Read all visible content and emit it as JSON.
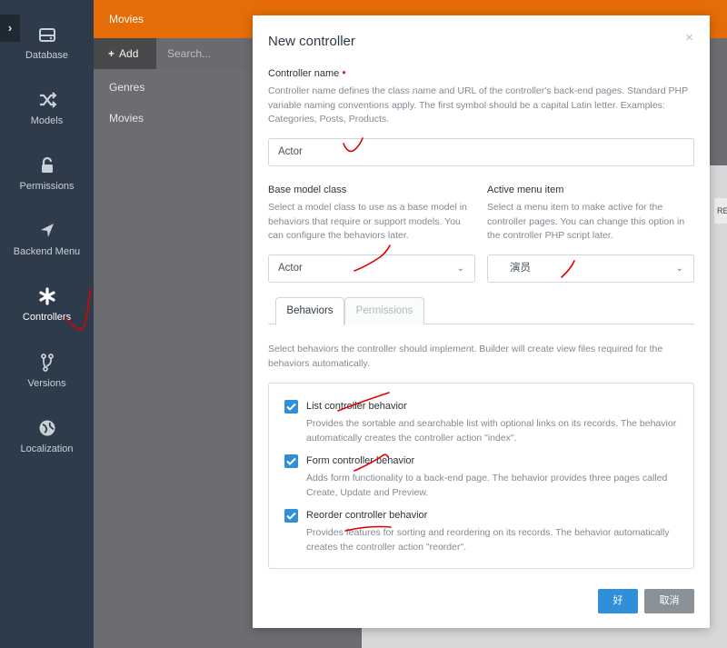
{
  "nav": {
    "items": [
      {
        "label": "Database",
        "icon": "database-icon"
      },
      {
        "label": "Models",
        "icon": "shuffle-icon"
      },
      {
        "label": "Permissions",
        "icon": "lock-icon"
      },
      {
        "label": "Backend Menu",
        "icon": "location-arrow-icon"
      },
      {
        "label": "Controllers",
        "icon": "asterisk-icon"
      },
      {
        "label": "Versions",
        "icon": "code-fork-icon"
      },
      {
        "label": "Localization",
        "icon": "globe-icon"
      }
    ],
    "active": "Controllers"
  },
  "background": {
    "plugin_title": "Movies",
    "add_label": "Add",
    "search_placeholder": "Search...",
    "list": [
      "Genres",
      "Movies"
    ],
    "column_hint": "RE"
  },
  "modal": {
    "title": "New controller",
    "close_symbol": "×",
    "controller_name": {
      "label": "Controller name",
      "required_mark": "•",
      "help": "Controller name defines the class name and URL of the controller's back-end pages. Standard PHP variable naming conventions apply. The first symbol should be a capital Latin letter. Examples: Categories, Posts, Products.",
      "value": "Actor"
    },
    "base_model": {
      "label": "Base model class",
      "help": "Select a model class to use as a base model in behaviors that require or support models. You can configure the behaviors later.",
      "value": "Actor"
    },
    "menu_item": {
      "label": "Active menu item",
      "help": "Select a menu item to make active for the controller pages. You can change this option in the controller PHP script later.",
      "value": "演员"
    },
    "tabs": [
      "Behaviors",
      "Permissions"
    ],
    "behaviors_intro": "Select behaviors the controller should implement. Builder will create view files required for the behaviors automatically.",
    "behaviors": [
      {
        "title": "List controller behavior",
        "checked": true,
        "desc": "Provides the sortable and searchable list with optional links on its records. The behavior automatically creates the controller action \"index\"."
      },
      {
        "title": "Form controller behavior",
        "checked": true,
        "desc": "Adds form functionality to a back-end page. The behavior provides three pages called Create, Update and Preview."
      },
      {
        "title": "Reorder controller behavior",
        "checked": true,
        "desc": "Provides features for sorting and reordering on its records. The behavior automatically creates the controller action \"reorder\"."
      }
    ],
    "ok_label": "好",
    "cancel_label": "取消"
  },
  "colors": {
    "accent": "#2f8fd9",
    "topbar": "#e56c07",
    "nav": "#2e3b4a",
    "annotation": "#e00000"
  }
}
